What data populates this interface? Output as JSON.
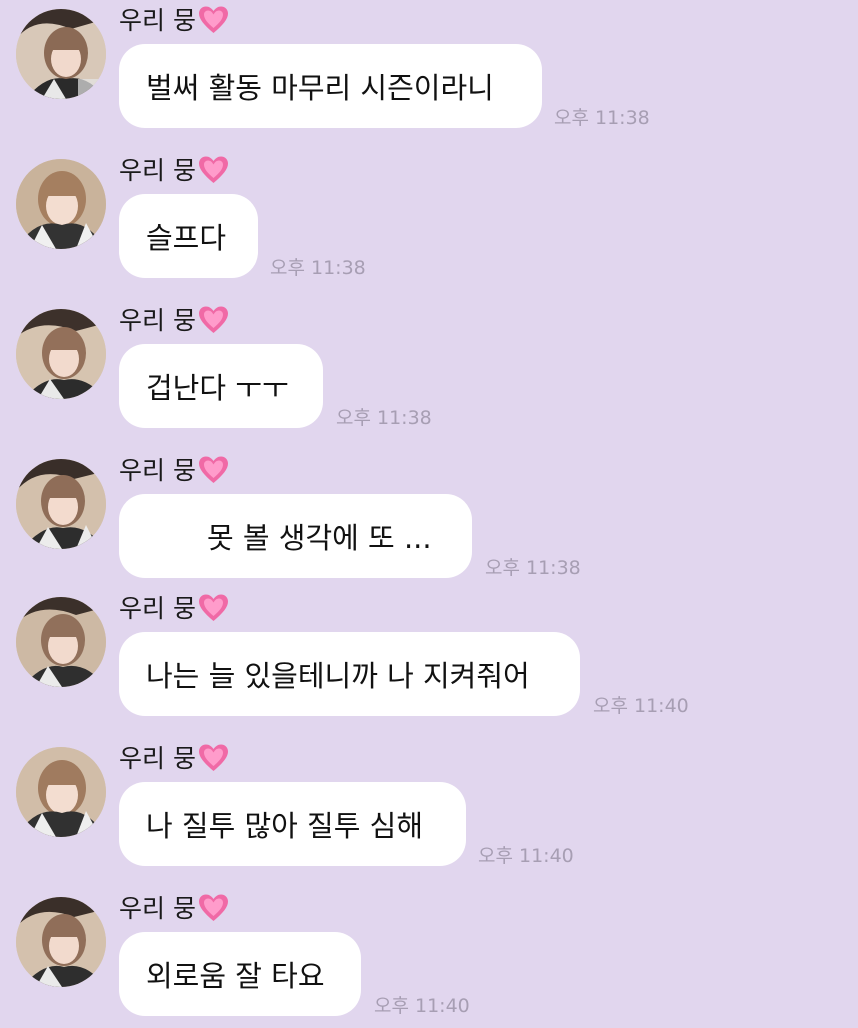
{
  "conversation": {
    "messages": [
      {
        "sender": "우리 뭉",
        "text": "벌써 활동 마무리 시즌이라니",
        "time": "오후 11:38"
      },
      {
        "sender": "우리 뭉",
        "text": "슬프다",
        "time": "오후 11:38"
      },
      {
        "sender": "우리 뭉",
        "text": "겁난다 ㅜㅜ",
        "time": "오후 11:38"
      },
      {
        "sender": "우리 뭉",
        "text": "못 볼 생각에 또 ...",
        "time": "오후 11:38"
      },
      {
        "sender": "우리 뭉",
        "text": "나는 늘 있을테니까 나 지켜줘어",
        "time": "오후 11:40"
      },
      {
        "sender": "우리 뭉",
        "text": "나 질투 많아 질투 심해",
        "time": "오후 11:40"
      },
      {
        "sender": "우리 뭉",
        "text": "외로움 잘 타요",
        "time": "오후 11:40"
      }
    ]
  },
  "icons": {
    "heart": "heart-icon",
    "avatar": "profile-avatar"
  },
  "colors": {
    "background": "#e1d6ee",
    "bubble": "#ffffff",
    "timestamp": "#a79eb3",
    "heart": "#f06aa6"
  }
}
